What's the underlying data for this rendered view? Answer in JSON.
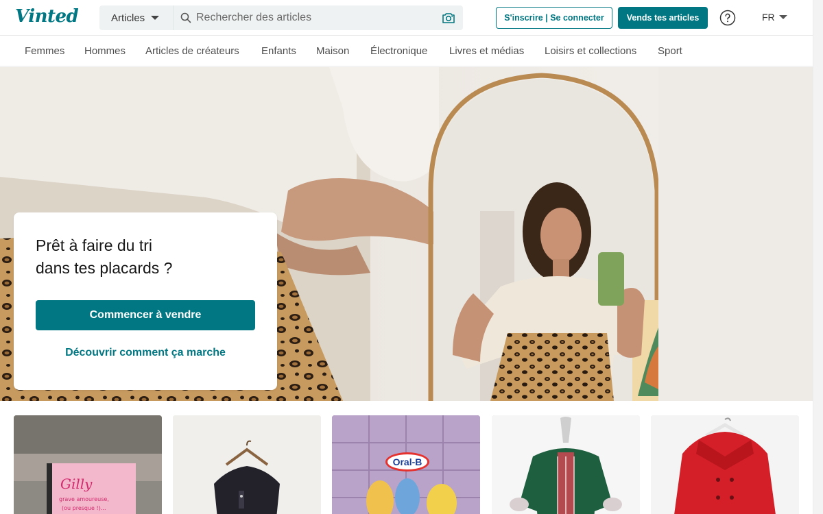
{
  "header": {
    "logo": "Vinted",
    "search": {
      "category": "Articles",
      "placeholder": "Rechercher des articles"
    },
    "login_label": "S'inscrire | Se connecter",
    "sell_label": "Vends tes articles",
    "language": "FR"
  },
  "nav": {
    "items": [
      "Femmes",
      "Hommes",
      "Articles de créateurs",
      "Enfants",
      "Maison",
      "Électronique",
      "Livres et médias",
      "Loisirs et collections",
      "Sport"
    ]
  },
  "hero": {
    "title_line1": "Prêt à faire du tri",
    "title_line2": "dans tes placards ?",
    "cta": "Commencer à vendre",
    "link": "Découvrir comment ça marche"
  },
  "products": {
    "book_title": "Gilly",
    "book_subtitle": "grave amoureuse,",
    "book_subtitle2": "(ou presque !)...",
    "toothbrush_brand": "Oral-B"
  },
  "colors": {
    "brand": "#007782",
    "text": "#171717",
    "nav_text": "#4d4d4d"
  },
  "icons": [
    "search-icon",
    "camera-icon",
    "help-icon",
    "chevron-down-icon"
  ]
}
